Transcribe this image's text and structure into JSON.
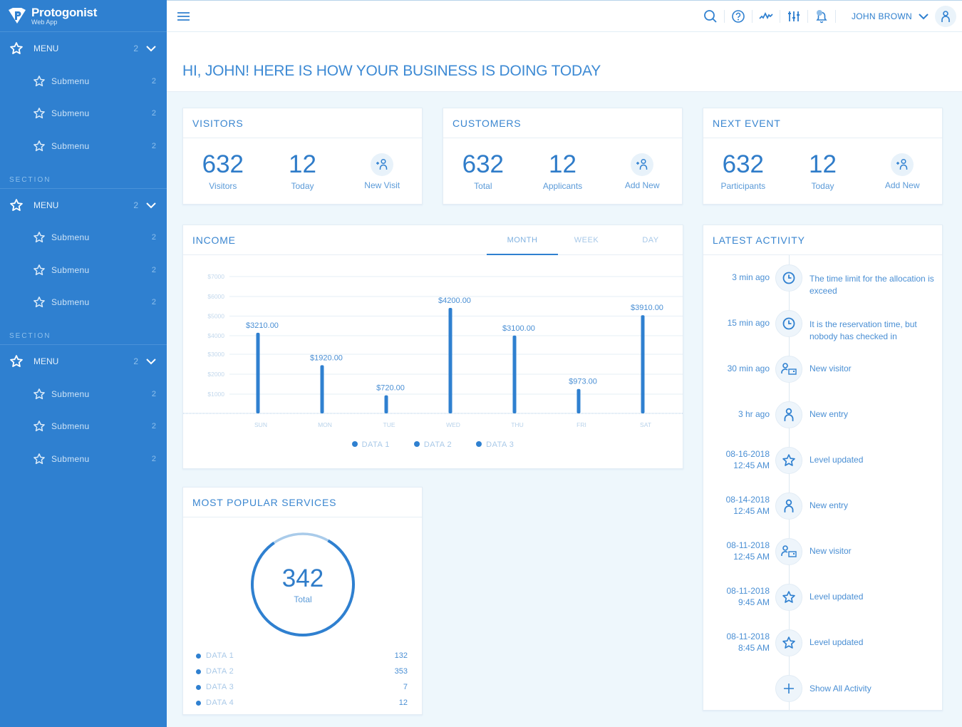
{
  "brand": {
    "name": "Protogonist",
    "subtitle": "Web App"
  },
  "colors": {
    "primary": "#2f80d0",
    "sidebar": "#2f80d0",
    "background": "#eef7fc",
    "text": "#2e7fce"
  },
  "sidebar": {
    "groups": [
      {
        "section": null,
        "menu": {
          "label": "MENU",
          "count": "2"
        },
        "submenus": [
          {
            "label": "Submenu",
            "count": "2"
          },
          {
            "label": "Submenu",
            "count": "2"
          },
          {
            "label": "Submenu",
            "count": "2"
          }
        ]
      },
      {
        "section": "SECTION",
        "menu": {
          "label": "MENU",
          "count": "2"
        },
        "submenus": [
          {
            "label": "Submenu",
            "count": "2"
          },
          {
            "label": "Submenu",
            "count": "2"
          },
          {
            "label": "Submenu",
            "count": "2"
          }
        ]
      },
      {
        "section": "SECTION",
        "menu": {
          "label": "MENU",
          "count": "2"
        },
        "submenus": [
          {
            "label": "Submenu",
            "count": "2"
          },
          {
            "label": "Submenu",
            "count": "2"
          },
          {
            "label": "Submenu",
            "count": "2"
          }
        ]
      }
    ]
  },
  "topbar": {
    "icons": [
      "search-icon",
      "help-icon",
      "activity-icon",
      "sliders-icon",
      "notification-bell-icon"
    ],
    "user_name": "JOHN BROWN"
  },
  "greeting": "HI, JOHN! HERE IS HOW YOUR BUSINESS IS DOING TODAY",
  "stat_cards": [
    {
      "title": "VISITORS",
      "primary": {
        "value": "632",
        "label": "Visitors"
      },
      "secondary": {
        "value": "12",
        "label": "Today"
      },
      "action": "New Visit"
    },
    {
      "title": "CUSTOMERS",
      "primary": {
        "value": "632",
        "label": "Total"
      },
      "secondary": {
        "value": "12",
        "label": "Applicants"
      },
      "action": "Add New"
    },
    {
      "title": "NEXT EVENT",
      "primary": {
        "value": "632",
        "label": "Participants"
      },
      "secondary": {
        "value": "12",
        "label": "Today"
      },
      "action": "Add New"
    }
  ],
  "income": {
    "title": "INCOME",
    "tabs": [
      {
        "label": "MONTH",
        "active": true
      },
      {
        "label": "WEEK",
        "active": false
      },
      {
        "label": "DAY",
        "active": false
      }
    ]
  },
  "chart_data": {
    "type": "bar",
    "title": "INCOME",
    "categories": [
      "SUN",
      "MON",
      "TUE",
      "WED",
      "THU",
      "FRI",
      "SAT"
    ],
    "values": [
      3210,
      1920,
      720,
      4200,
      3100,
      973,
      3910
    ],
    "value_labels": [
      "$3210.00",
      "$1920.00",
      "$720.00",
      "$4200.00",
      "$3100.00",
      "$973.00",
      "$3910.00"
    ],
    "yticks": [
      "$7000",
      "$6000",
      "$5000",
      "$4000",
      "$3000",
      "$2000",
      "$1000"
    ],
    "ylim": [
      0,
      7000
    ],
    "legend": [
      "DATA 1",
      "DATA 2",
      "DATA 3"
    ],
    "legend_position": "bottom-center",
    "grid": true,
    "xlabel": "",
    "ylabel": ""
  },
  "popular_services": {
    "title": "MOST POPULAR SERVICES",
    "total_value": "342",
    "total_label": "Total",
    "ring_fill_fraction": 0.82,
    "items": [
      {
        "label": "DATA 1",
        "value": "132"
      },
      {
        "label": "DATA 2",
        "value": "353"
      },
      {
        "label": "DATA 3",
        "value": "7"
      },
      {
        "label": "DATA 4",
        "value": "12"
      }
    ]
  },
  "activity": {
    "title": "LATEST ACTIVITY",
    "items": [
      {
        "time": "3 min ago",
        "time2": "",
        "icon": "clock-icon",
        "text": "The time limit for the allocation is exceed"
      },
      {
        "time": "15 min ago",
        "time2": "",
        "icon": "clock-icon",
        "text": "It is the reservation time, but nobody has checked in"
      },
      {
        "time": "30 min ago",
        "time2": "",
        "icon": "visitor-card-icon",
        "text": "New visitor"
      },
      {
        "time": "3 hr ago",
        "time2": "",
        "icon": "person-icon",
        "text": "New entry"
      },
      {
        "time": "08-16-2018",
        "time2": "12:45 AM",
        "icon": "star-icon",
        "text": "Level updated"
      },
      {
        "time": "08-14-2018",
        "time2": "12:45 AM",
        "icon": "person-icon",
        "text": "New entry"
      },
      {
        "time": "08-11-2018",
        "time2": "12:45 AM",
        "icon": "visitor-card-icon",
        "text": "New visitor"
      },
      {
        "time": "08-11-2018",
        "time2": "9:45 AM",
        "icon": "star-icon",
        "text": "Level updated"
      },
      {
        "time": "08-11-2018",
        "time2": "8:45 AM",
        "icon": "star-icon",
        "text": "Level updated"
      }
    ],
    "show_all_label": "Show All Activity"
  }
}
